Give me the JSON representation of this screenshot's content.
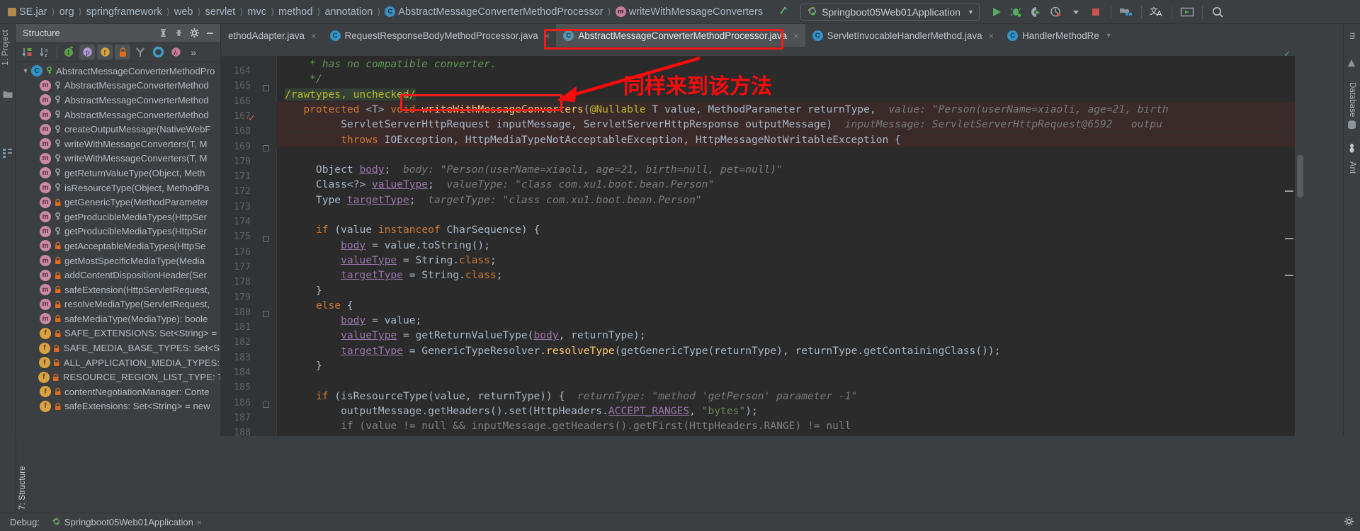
{
  "window": {
    "theme_bg": "#3c3f41",
    "editor_bg": "#2b2b2b",
    "accent_red": "#f41b1b"
  },
  "navbar": {
    "breadcrumbs": [
      {
        "label": "SE.jar",
        "icon": "jar-icon"
      },
      {
        "label": "org",
        "icon": "package-icon"
      },
      {
        "label": "springframework",
        "icon": "package-icon"
      },
      {
        "label": "web",
        "icon": "package-icon"
      },
      {
        "label": "servlet",
        "icon": "package-icon"
      },
      {
        "label": "mvc",
        "icon": "package-icon"
      },
      {
        "label": "method",
        "icon": "package-icon"
      },
      {
        "label": "annotation",
        "icon": "package-icon"
      },
      {
        "label": "AbstractMessageConverterMethodProcessor",
        "icon": "class-icon"
      },
      {
        "label": "writeWithMessageConverters",
        "icon": "method-icon"
      }
    ],
    "run_config": {
      "label": "Springboot05Web01Application",
      "icon": "spring-boot-icon",
      "caret": "▼"
    },
    "toolbar_buttons": [
      {
        "name": "run-button",
        "icon": "play-icon",
        "color": "#59a869"
      },
      {
        "name": "debug-button",
        "icon": "bug-icon",
        "color": "#59a869"
      },
      {
        "name": "run-with-coverage-button",
        "icon": "coverage-icon",
        "color": "#9aa7b0"
      },
      {
        "name": "profiler-button",
        "icon": "profile-icon",
        "color": "#9aa7b0"
      },
      {
        "name": "profiler-dropdown",
        "icon": "chevron-down-icon",
        "color": "#b6b6b6"
      },
      {
        "name": "stop-button",
        "icon": "stop-icon",
        "color": "#c75450"
      },
      {
        "name": "project-structure-button",
        "icon": "project-structure-icon",
        "color": "#9aa7b0"
      },
      {
        "name": "translate-button",
        "icon": "translate-icon",
        "color": "#d6d6d6"
      },
      {
        "name": "terminal-button",
        "icon": "terminal-icon",
        "color": "#9aa7b0"
      },
      {
        "name": "search-everywhere-button",
        "icon": "search-icon",
        "color": "#b9c0c6"
      }
    ]
  },
  "left_strip": {
    "tabs": [
      {
        "label": "1: Project",
        "name": "tool-window-project"
      },
      {
        "label": "7: Structure",
        "name": "tool-window-structure"
      }
    ]
  },
  "right_strip": {
    "tabs": [
      {
        "label": "m",
        "name": "tool-window-maven"
      },
      {
        "label": "Database",
        "name": "tool-window-database"
      },
      {
        "label": "Ant",
        "name": "tool-window-ant"
      }
    ]
  },
  "structure_panel": {
    "title": "Structure",
    "header_buttons": [
      {
        "name": "expand-all-button",
        "icon": "expand-all-icon"
      },
      {
        "name": "collapse-all-button",
        "icon": "collapse-all-icon"
      },
      {
        "name": "settings-button",
        "icon": "gear-icon"
      },
      {
        "name": "hide-button",
        "icon": "minimize-icon"
      }
    ],
    "toolbar_buttons": [
      {
        "name": "sort-by-visibility-button",
        "icon": "sort-visibility-icon",
        "active": false
      },
      {
        "name": "sort-alphabetically-button",
        "icon": "sort-alpha-icon",
        "active": false
      },
      {
        "name": "show-inherited-button",
        "icon": "inherited-icon",
        "active": false
      },
      {
        "name": "show-properties-button",
        "icon": "properties-icon",
        "active": true
      },
      {
        "name": "show-fields-button",
        "icon": "fields-icon",
        "active": true
      },
      {
        "name": "show-non-public-button",
        "icon": "lock-icon",
        "active": true
      },
      {
        "name": "group-methods-button",
        "icon": "group-icon",
        "active": false
      },
      {
        "name": "show-anonymous-button",
        "icon": "anonymous-icon",
        "active": false
      },
      {
        "name": "show-lambdas-button",
        "icon": "lambda-icon",
        "active": false
      },
      {
        "name": "more-button",
        "icon": "chevron-right-icon",
        "active": false
      }
    ],
    "tree": [
      {
        "kind": "class",
        "icon": "class-icon",
        "vis": "public",
        "label": "AbstractMessageConverterMethodPro",
        "indent": 0,
        "expanded": true
      },
      {
        "kind": "method",
        "icon": "method-icon",
        "vis": "protected",
        "label": "AbstractMessageConverterMethod",
        "indent": 1
      },
      {
        "kind": "method",
        "icon": "method-icon",
        "vis": "protected",
        "label": "AbstractMessageConverterMethod",
        "indent": 1
      },
      {
        "kind": "method",
        "icon": "method-icon",
        "vis": "protected",
        "label": "AbstractMessageConverterMethod",
        "indent": 1
      },
      {
        "kind": "method",
        "icon": "method-icon",
        "vis": "protected",
        "label": "createOutputMessage(NativeWebF",
        "indent": 1
      },
      {
        "kind": "method",
        "icon": "method-icon",
        "vis": "protected",
        "label": "writeWithMessageConverters(T, M",
        "indent": 1
      },
      {
        "kind": "method",
        "icon": "method-icon",
        "vis": "protected",
        "label": "writeWithMessageConverters(T, M",
        "indent": 1
      },
      {
        "kind": "method",
        "icon": "method-icon",
        "vis": "protected",
        "label": "getReturnValueType(Object, Meth",
        "indent": 1
      },
      {
        "kind": "method",
        "icon": "method-icon",
        "vis": "protected",
        "label": "isResourceType(Object, MethodPa",
        "indent": 1
      },
      {
        "kind": "method",
        "icon": "method-icon",
        "vis": "private",
        "label": "getGenericType(MethodParameter",
        "indent": 1
      },
      {
        "kind": "method",
        "icon": "method-icon",
        "vis": "protected",
        "label": "getProducibleMediaTypes(HttpSer",
        "indent": 1
      },
      {
        "kind": "method",
        "icon": "method-icon",
        "vis": "protected",
        "label": "getProducibleMediaTypes(HttpSer",
        "indent": 1
      },
      {
        "kind": "method",
        "icon": "method-icon",
        "vis": "private",
        "label": "getAcceptableMediaTypes(HttpSe",
        "indent": 1
      },
      {
        "kind": "method",
        "icon": "method-icon",
        "vis": "private",
        "label": "getMostSpecificMediaType(Media",
        "indent": 1
      },
      {
        "kind": "method",
        "icon": "method-icon",
        "vis": "private",
        "label": "addContentDispositionHeader(Ser",
        "indent": 1
      },
      {
        "kind": "method",
        "icon": "method-icon",
        "vis": "private",
        "label": "safeExtension(HttpServletRequest,",
        "indent": 1
      },
      {
        "kind": "method",
        "icon": "method-icon",
        "vis": "private",
        "label": "resolveMediaType(ServletRequest,",
        "indent": 1
      },
      {
        "kind": "method",
        "icon": "method-icon",
        "vis": "private",
        "label": "safeMediaType(MediaType): boole",
        "indent": 1
      },
      {
        "kind": "field",
        "icon": "field-icon",
        "vis": "private",
        "label": "SAFE_EXTENSIONS: Set<String> =",
        "indent": 1
      },
      {
        "kind": "field",
        "icon": "field-icon",
        "vis": "private",
        "label": "SAFE_MEDIA_BASE_TYPES: Set<Stri",
        "indent": 1
      },
      {
        "kind": "field",
        "icon": "field-icon",
        "vis": "private",
        "label": "ALL_APPLICATION_MEDIA_TYPES: L",
        "indent": 1
      },
      {
        "kind": "field",
        "icon": "field-icon",
        "vis": "private",
        "label": "RESOURCE_REGION_LIST_TYPE: Typ",
        "indent": 1
      },
      {
        "kind": "field",
        "icon": "field-icon",
        "vis": "private",
        "label": "contentNegotiationManager: Conte",
        "indent": 1
      },
      {
        "kind": "field",
        "icon": "field-icon",
        "vis": "private",
        "label": "safeExtensions: Set<String> = new",
        "indent": 1
      }
    ]
  },
  "editor_tabs": [
    {
      "label": "ethodAdapter.java",
      "icon": null,
      "active": false,
      "close": "×",
      "name": "tab-method-adapter"
    },
    {
      "label": "RequestResponseBodyMethodProcessor.java",
      "icon": "class-icon",
      "active": false,
      "close": "×",
      "name": "tab-request-response-body-method-processor"
    },
    {
      "label": "AbstractMessageConverterMethodProcessor.java",
      "icon": "abstract-class-icon",
      "active": true,
      "close": "×",
      "name": "tab-abstract-message-converter-method-processor"
    },
    {
      "label": "ServletInvocableHandlerMethod.java",
      "icon": "class-icon",
      "active": false,
      "close": "×",
      "name": "tab-servlet-invocable-handler-method"
    },
    {
      "label": "HandlerMethodRe",
      "icon": "class-icon",
      "active": false,
      "close": "",
      "name": "tab-handler-method-re"
    }
  ],
  "code": {
    "first_line_number": 164,
    "lines": [
      {
        "num": 164,
        "html": "    <span class=\"cmt\">* has no compatible converter.</span>",
        "fold": false
      },
      {
        "num": 165,
        "html": "    <span class=\"cmt\">*/</span>",
        "fold": true
      },
      {
        "num": 166,
        "html": "<span class=\"annot-sel\"><span class=\"ann\">/rawtypes, unchecked/</span></span>",
        "fold": false
      },
      {
        "num": 167,
        "html": "   <span class=\"kw\">protected</span> &lt;T&gt; <span class=\"kw\">void</span> <span class=\"mth\">writeWithMessageConverters</span>(<span class=\"ann\">@Nullable</span> T value, MethodParameter returnType,  <span class=\"hint\">value: \"Person(userName=xiaoli, age=21, birth</span>",
        "fold": false,
        "highlight": true
      },
      {
        "num": 168,
        "html": "         ServletServerHttpRequest inputMessage, ServletServerHttpResponse outputMessage)  <span class=\"hint\">inputMessage: ServletServerHttpRequest@6592   outpu</span>",
        "fold": false,
        "highlight": true
      },
      {
        "num": 169,
        "html": "         <span class=\"kw\">throws</span> IOException, HttpMediaTypeNotAcceptableException, HttpMessageNotWritableException {",
        "fold": true,
        "highlight": true
      },
      {
        "num": 170,
        "html": "",
        "fold": false
      },
      {
        "num": 171,
        "html": "     Object <span class=\"fld\">body</span>;  <span class=\"hint\">body: \"Person(userName=xiaoli, age=21, birth=null, pet=null)\"</span>",
        "fold": false
      },
      {
        "num": 172,
        "html": "     Class&lt;?&gt; <span class=\"fld\">valueType</span>;  <span class=\"hint\">valueType: \"class com.xu1.boot.bean.Person\"</span>",
        "fold": false
      },
      {
        "num": 173,
        "html": "     Type <span class=\"fld\">targetType</span>;  <span class=\"hint\">targetType: \"class com.xu1.boot.bean.Person\"</span>",
        "fold": false
      },
      {
        "num": 174,
        "html": "",
        "fold": false
      },
      {
        "num": 175,
        "html": "     <span class=\"kw\">if</span> (value <span class=\"kw\">instanceof</span> CharSequence) {",
        "fold": true
      },
      {
        "num": 176,
        "html": "         <span class=\"fld\">body</span> = value.toString();",
        "fold": false
      },
      {
        "num": 177,
        "html": "         <span class=\"fld\">valueType</span> = String.<span class=\"kw\">class</span>;",
        "fold": false
      },
      {
        "num": 178,
        "html": "         <span class=\"fld\">targetType</span> = String.<span class=\"kw\">class</span>;",
        "fold": false
      },
      {
        "num": 179,
        "html": "     }",
        "fold": false
      },
      {
        "num": 180,
        "html": "     <span class=\"kw\">else</span> {",
        "fold": true
      },
      {
        "num": 181,
        "html": "         <span class=\"fld\">body</span> = value;",
        "fold": false
      },
      {
        "num": 182,
        "html": "         <span class=\"fld\">valueType</span> = getReturnValueType(<span class=\"fld\">body</span>, returnType);",
        "fold": false
      },
      {
        "num": 183,
        "html": "         <span class=\"fld\">targetType</span> = GenericTypeResolver.<span class=\"mth\">resolveType</span>(getGenericType(returnType), returnType.getContainingClass());",
        "fold": false
      },
      {
        "num": 184,
        "html": "     }",
        "fold": false
      },
      {
        "num": 185,
        "html": "",
        "fold": false
      },
      {
        "num": 186,
        "html": "     <span class=\"kw\">if</span> (isResourceType(value, returnType)) {  <span class=\"hint\">returnType: \"method 'getPerson' parameter -1\"</span>",
        "fold": true
      },
      {
        "num": 187,
        "html": "         outputMessage.getHeaders().set(HttpHeaders.<span class=\"fld\">ACCEPT_RANGES</span>, <span class=\"str\">\"bytes\"</span>);",
        "fold": false
      },
      {
        "num": 188,
        "html": "         <span class=\"gray\">if (value != null &amp;&amp; inputMessage.getHeaders().getFirst(HttpHeaders.RANGE) != null</span>",
        "fold": false
      }
    ]
  },
  "annotations": {
    "tab_box": {
      "name": "tab-highlight-box"
    },
    "method_box": {
      "name": "method-name-highlight-box"
    },
    "note_text": "同样来到该方法"
  },
  "bottom_bar": {
    "items": [
      {
        "label": "Debug:",
        "icon": null,
        "name": "debug-label"
      },
      {
        "label": "Springboot05Web01Application",
        "icon": "spring-boot-icon",
        "close": "×",
        "name": "debug-session-tab"
      }
    ],
    "right_icons": [
      {
        "name": "event-log-icon",
        "icon": "gear-icon"
      }
    ]
  }
}
